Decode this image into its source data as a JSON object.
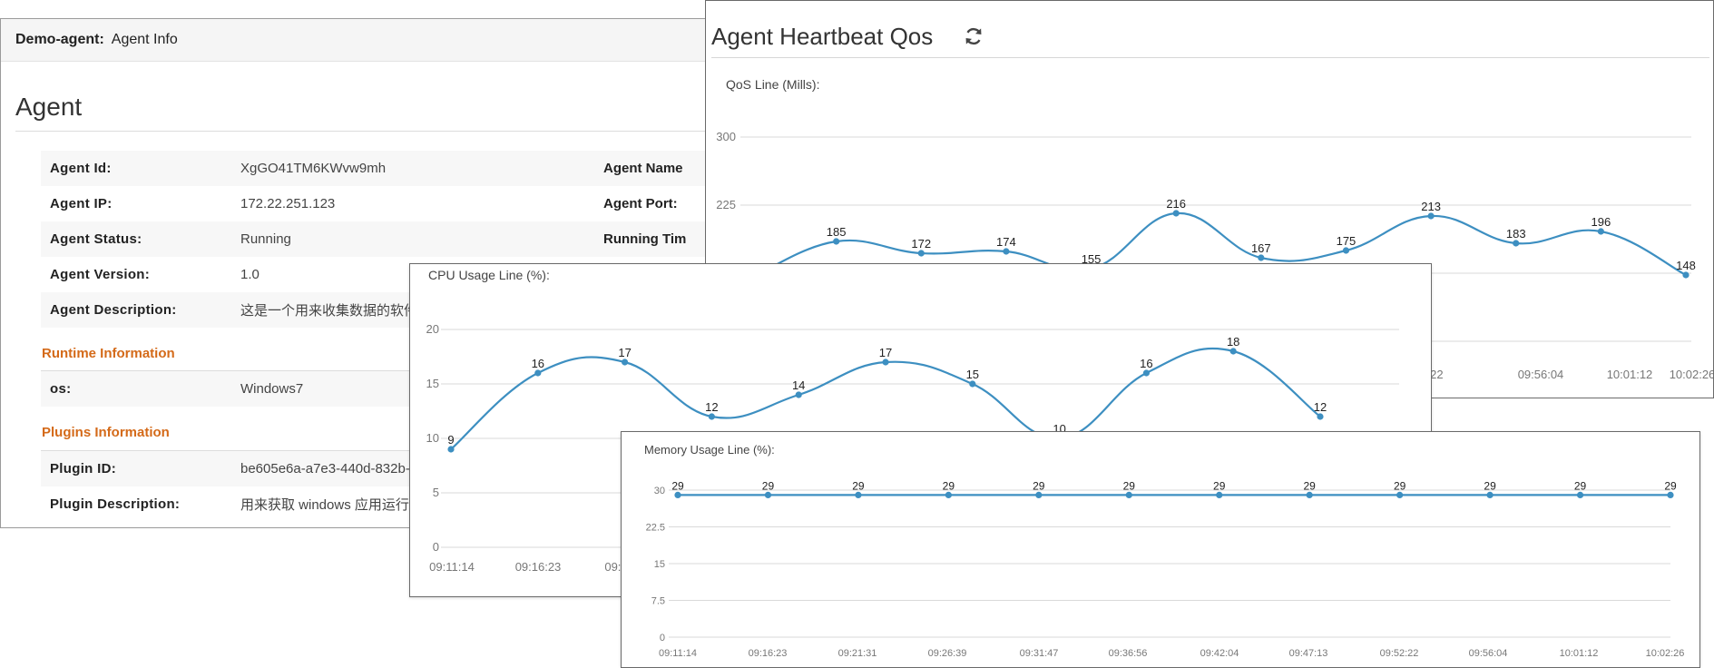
{
  "agent_info": {
    "header_agent": "Demo-agent:",
    "header_section": "Agent Info",
    "title": "Agent",
    "rows": [
      {
        "key": "Agent Id:",
        "value": "XgGO41TM6KWvw9mh",
        "key2": "Agent Name"
      },
      {
        "key": "Agent IP:",
        "value": "172.22.251.123",
        "key2": "Agent Port:"
      },
      {
        "key": "Agent Status:",
        "value": "Running",
        "key2": "Running Tim"
      },
      {
        "key": "Agent Version:",
        "value": "1.0",
        "key2": ""
      },
      {
        "key": "Agent Description:",
        "value": "这是一个用来收集数据的软件",
        "key2": ""
      }
    ],
    "runtime_title": "Runtime Information",
    "runtime_rows": [
      {
        "key": "os:",
        "value": "Windows7"
      }
    ],
    "plugins_title": "Plugins Information",
    "plugins_rows": [
      {
        "key": "Plugin ID:",
        "value": "be605e6a-a7e3-440d-832b-"
      },
      {
        "key": "Plugin Description:",
        "value": "用来获取 windows 应用运行"
      }
    ]
  },
  "heartbeat": {
    "title": "Agent Heartbeat Qos",
    "refresh_icon": "refresh-icon"
  },
  "colors": {
    "line": "#3d8fc1",
    "section": "#d46a19",
    "grid": "#d9d9d9"
  },
  "chart_data": [
    {
      "id": "qos",
      "type": "line",
      "title": "QoS Line (Mills):",
      "y_ticks": [
        "300",
        "225",
        "150"
      ],
      "x_ticks": [
        "2:22",
        "09:56:04",
        "10:01:12",
        "10:02:26"
      ],
      "values": [
        145,
        185,
        172,
        174,
        155,
        216,
        167,
        175,
        213,
        183,
        196,
        148
      ],
      "ylim": [
        0,
        300
      ]
    },
    {
      "id": "cpu",
      "type": "line",
      "title": "CPU Usage Line (%):",
      "y_ticks": [
        "20",
        "15",
        "10",
        "5",
        "0"
      ],
      "x_ticks": [
        "09:11:14",
        "09:16:23",
        "09:2"
      ],
      "values": [
        9,
        16,
        17,
        12,
        14,
        17,
        15,
        10,
        16,
        18,
        12
      ],
      "ylim": [
        0,
        20
      ]
    },
    {
      "id": "mem",
      "type": "line",
      "title": "Memory Usage Line (%):",
      "y_ticks": [
        "30",
        "22.5",
        "15",
        "7.5",
        "0"
      ],
      "x_ticks": [
        "09:11:14",
        "09:16:23",
        "09:21:31",
        "09:26:39",
        "09:31:47",
        "09:36:56",
        "09:42:04",
        "09:47:13",
        "09:52:22",
        "09:56:04",
        "10:01:12",
        "10:02:26"
      ],
      "values": [
        29,
        29,
        29,
        29,
        29,
        29,
        29,
        29,
        29,
        29,
        29,
        29
      ],
      "ylim": [
        0,
        30
      ]
    }
  ]
}
